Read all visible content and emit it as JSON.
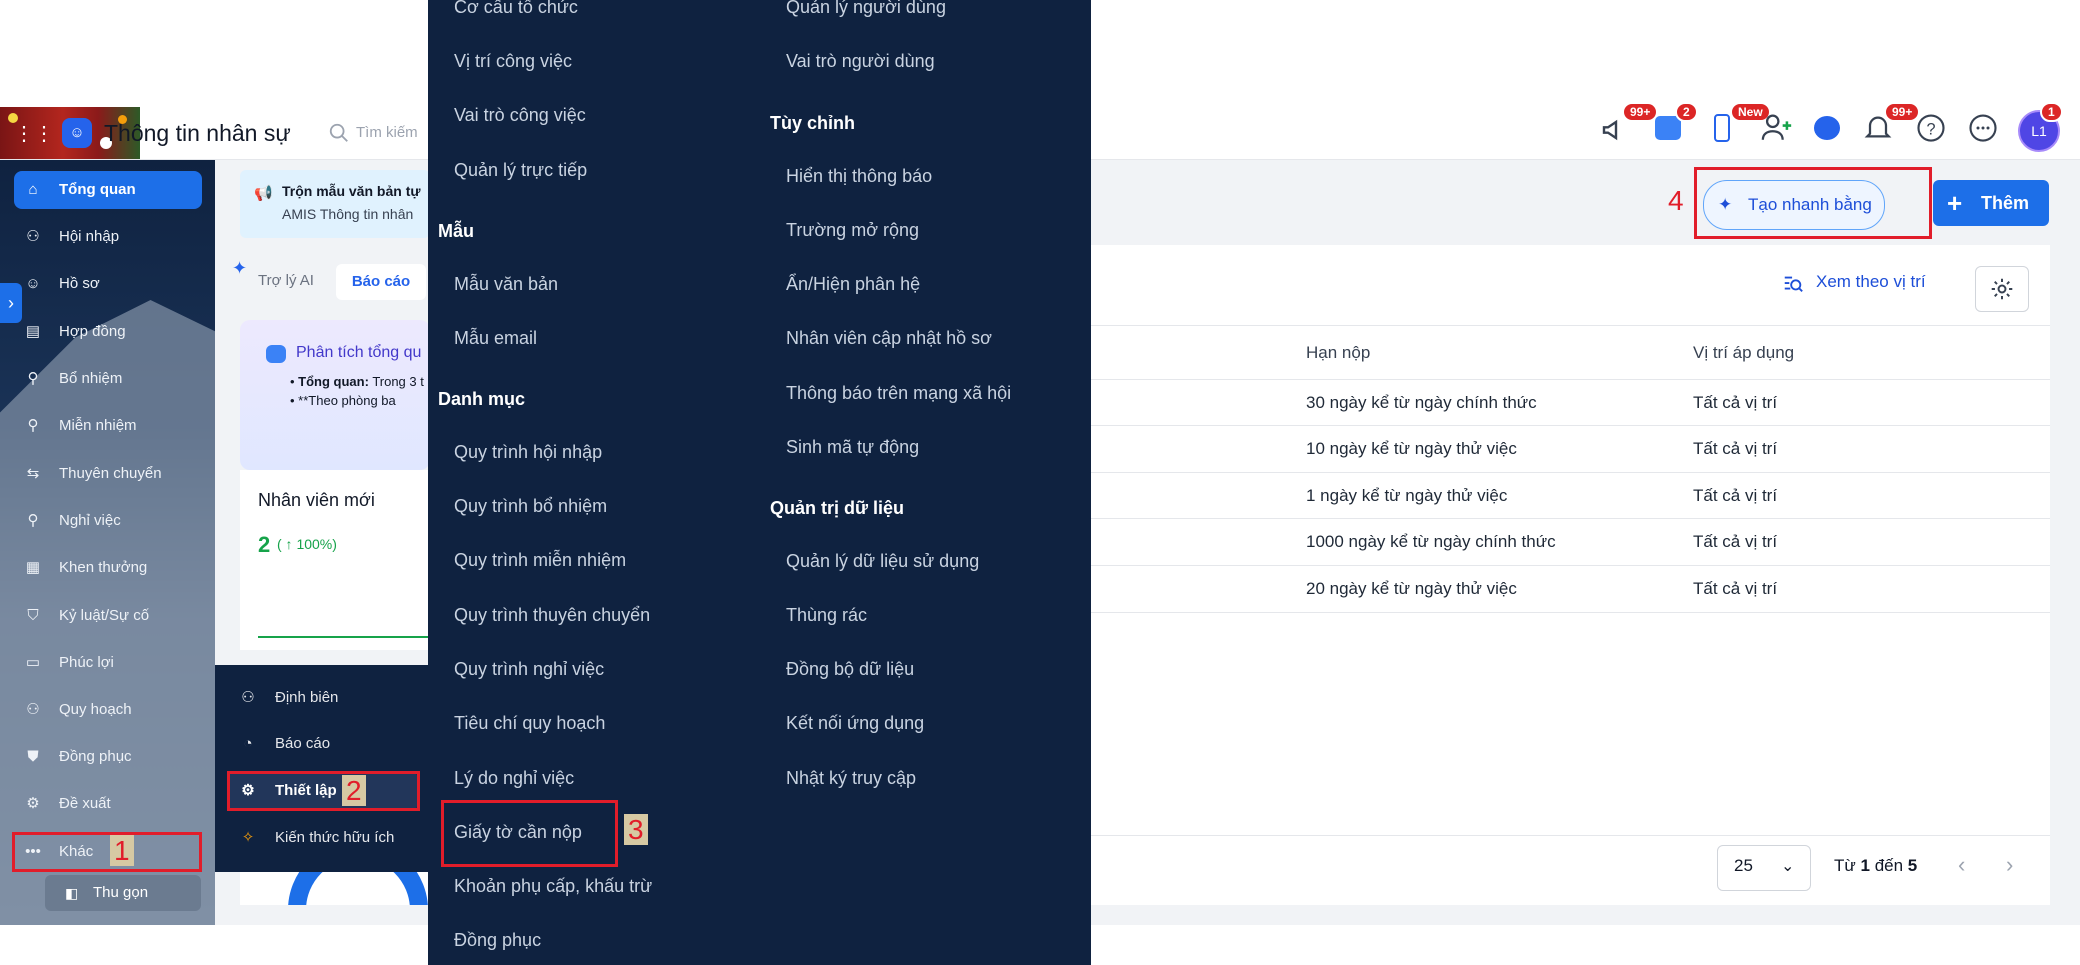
{
  "header": {
    "app_title": "Thông tin nhân sự",
    "search_placeholder": "Tìm kiếm",
    "badges": {
      "announcements": "99+",
      "store": "2",
      "mobile": "New",
      "notifications": "99+",
      "avatar": "1"
    },
    "avatar_initials": "L1"
  },
  "sidebar": {
    "items": [
      {
        "label": "Tổng quan",
        "icon": "home-icon"
      },
      {
        "label": "Hội nhập",
        "icon": "onboarding-icon"
      },
      {
        "label": "Hồ sơ",
        "icon": "profile-icon"
      },
      {
        "label": "Hợp đồng",
        "icon": "contract-icon"
      },
      {
        "label": "Bổ nhiệm",
        "icon": "appoint-icon"
      },
      {
        "label": "Miễn nhiệm",
        "icon": "dismiss-icon"
      },
      {
        "label": "Thuyên chuyển",
        "icon": "transfer-icon"
      },
      {
        "label": "Nghỉ việc",
        "icon": "resign-icon"
      },
      {
        "label": "Khen thưởng",
        "icon": "reward-icon"
      },
      {
        "label": "Kỷ luật/Sự cố",
        "icon": "discipline-icon"
      },
      {
        "label": "Phúc lợi",
        "icon": "welfare-icon"
      },
      {
        "label": "Quy hoạch",
        "icon": "planning-icon"
      },
      {
        "label": "Đồng phục",
        "icon": "uniform-icon"
      },
      {
        "label": "Đề xuất",
        "icon": "proposal-icon"
      },
      {
        "label": "Khác",
        "icon": "more-icon"
      }
    ],
    "collapse_label": "Thu gọn"
  },
  "submenu": {
    "items": [
      {
        "label": "Định biên"
      },
      {
        "label": "Báo cáo"
      },
      {
        "label": "Thiết lập"
      },
      {
        "label": "Kiến thức hữu ích"
      }
    ]
  },
  "dashboard": {
    "banner_line1": "Trộn mẫu văn bản tự",
    "banner_line2": "AMIS Thông tin nhân",
    "tab_ai": "Trợ lý AI",
    "tab_report": "Báo cáo",
    "ai_card_title": "Phân tích tổng qu",
    "ai_card_line1_bold": "Tổng quan:",
    "ai_card_line1": " Trong 3 t",
    "ai_card_line2": "**Theo phòng ba",
    "stat_title": "Nhân viên mới",
    "stat_value": "2",
    "stat_delta": "( ↑ 100%)"
  },
  "mega_menu": {
    "col1": {
      "top_items": [
        "Cơ cấu tổ chức",
        "Vị trí công việc",
        "Vai trò công việc",
        "Quản lý trực tiếp"
      ],
      "sections": [
        {
          "title": "Mẫu",
          "items": [
            "Mẫu văn bản",
            "Mẫu email"
          ]
        },
        {
          "title": "Danh mục",
          "items": [
            "Quy trình hội nhập",
            "Quy trình bổ nhiệm",
            "Quy trình miễn nhiệm",
            "Quy trình thuyên chuyển",
            "Quy trình nghỉ việc",
            "Tiêu chí quy hoạch",
            "Lý do nghỉ việc",
            "Giấy tờ cần nộp",
            "Khoản phụ cấp, khấu trừ",
            "Đồng phục"
          ]
        }
      ]
    },
    "col2": {
      "top_items": [
        "Quản lý người dùng",
        "Vai trò người dùng"
      ],
      "sections": [
        {
          "title": "Tùy chỉnh",
          "items": [
            "Hiển thị thông báo",
            "Trường mở rộng",
            "Ẩn/Hiện phân hệ",
            "Nhân viên cập nhật hồ sơ",
            "Thông báo trên mạng xã hội",
            "Sinh mã tự động"
          ]
        },
        {
          "title": "Quản trị dữ liệu",
          "items": [
            "Quản lý dữ liệu sử dụng",
            "Thùng rác",
            "Đồng bộ dữ liệu",
            "Kết nối ứng dụng",
            "Nhật ký truy cập"
          ]
        }
      ]
    }
  },
  "toolbar": {
    "ai_create_label": "Tạo nhanh bằng AI",
    "add_label": "Thêm",
    "view_by_position_label": "Xem theo vị trí"
  },
  "table": {
    "headers": [
      "Hạn nộp",
      "Vị trí áp dụng"
    ],
    "rows": [
      [
        "30 ngày kể từ ngày chính thức",
        "Tất cả vị trí"
      ],
      [
        "10 ngày kể từ ngày thử việc",
        "Tất cả vị trí"
      ],
      [
        "1 ngày kể từ ngày thử việc",
        "Tất cả vị trí"
      ],
      [
        "1000 ngày kể từ ngày chính thức",
        "Tất cả vị trí"
      ],
      [
        "20 ngày kể từ ngày thử việc",
        "Tất cả vị trí"
      ]
    ]
  },
  "pager": {
    "page_size": "25",
    "range_prefix": "Từ ",
    "range_from": "1",
    "range_mid": " đến ",
    "range_to": "5"
  },
  "annotations": [
    "1",
    "2",
    "3",
    "4"
  ],
  "colors": {
    "accent": "#1d6fe8",
    "menu_bg": "#0f2240",
    "annotation": "#e11d2a"
  }
}
